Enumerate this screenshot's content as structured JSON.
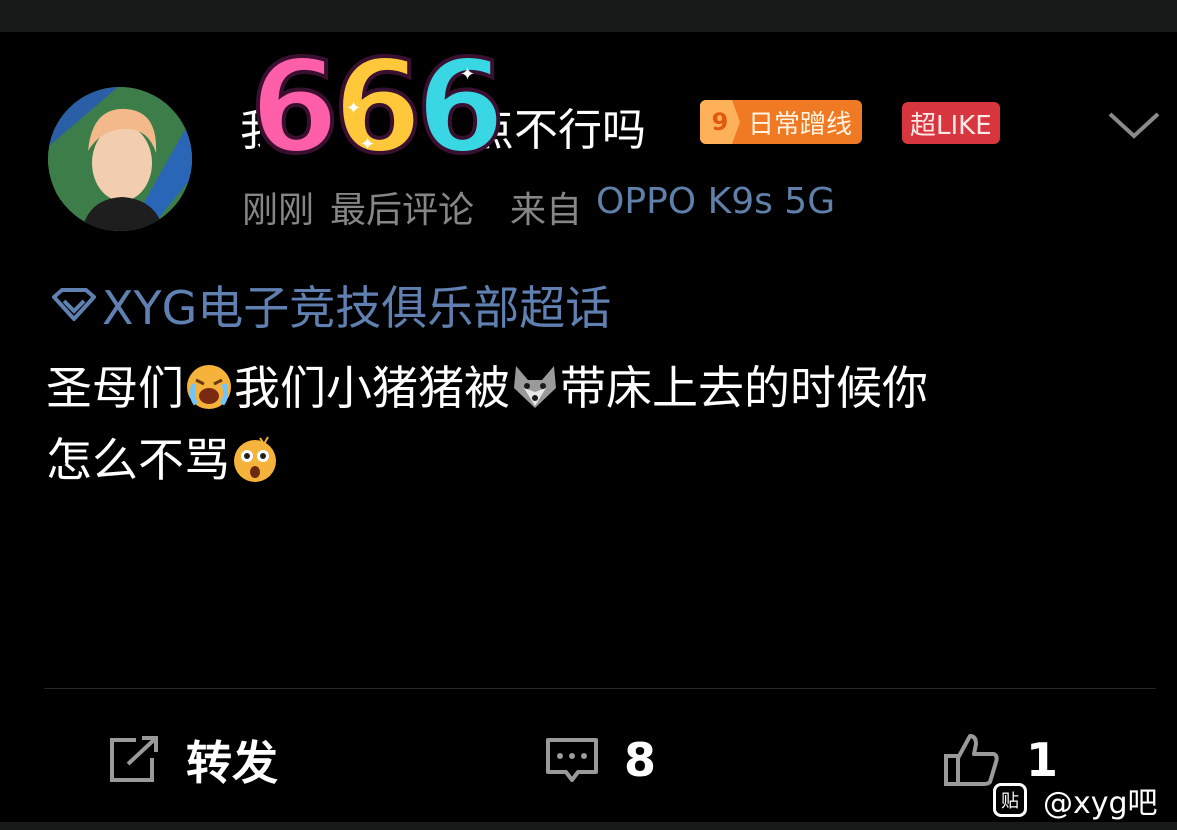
{
  "post": {
    "author": {
      "name_prefix": "我",
      "name_suffix": "点不行吗",
      "sticker_text": "666",
      "level": "9",
      "level_badge": "日常蹭线",
      "like_badge": "超LIKE"
    },
    "meta": {
      "time": "刚刚",
      "last_comment": "最后评论",
      "source_label": "来自",
      "device": "OPPO K9s 5G"
    },
    "topic": "XYG电子竞技俱乐部超话",
    "body": {
      "line1_part1": "圣母们",
      "line1_part2": "我们小猪猪被",
      "line1_part3": "带床上去的时候你",
      "line2_part1": "怎么不骂"
    },
    "emoji": {
      "crying": "crying-face-emoji",
      "wolf": "wolf-emoji",
      "shocked": "shocked-face-emoji"
    }
  },
  "actions": {
    "repost_label": "转发",
    "comment_count": "8",
    "like_count": "1"
  },
  "watermark": {
    "logo": "贴",
    "text": "@xyg吧"
  },
  "colors": {
    "background": "#000000",
    "topic_blue": "#5f80b0",
    "meta_gray": "#868686",
    "level_orange": "#f07a24",
    "like_red": "#d8363f"
  }
}
